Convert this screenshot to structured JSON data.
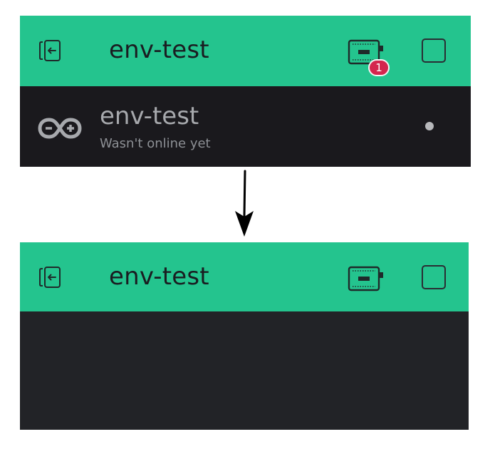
{
  "colors": {
    "header_bg": "#24c48e",
    "device_list_bg": "#1a191d",
    "dashboard_bg": "#222327",
    "badge_bg": "#d4264e",
    "arrow": "#000000"
  },
  "before": {
    "header": {
      "title": "env-test",
      "back_icon": "exit-project-icon",
      "device_icon": "device-board-icon",
      "device_badge_count": "1",
      "square_icon": "square-outline-icon"
    },
    "device_list": [
      {
        "icon": "arduino-infinity-icon",
        "name": "env-test",
        "status": "Wasn't online yet",
        "indicator": "offline-dot"
      }
    ]
  },
  "transition_icon": "down-arrow-icon",
  "after": {
    "header": {
      "title": "env-test",
      "back_icon": "exit-project-icon",
      "device_icon": "device-board-icon",
      "square_icon": "square-outline-icon"
    }
  }
}
